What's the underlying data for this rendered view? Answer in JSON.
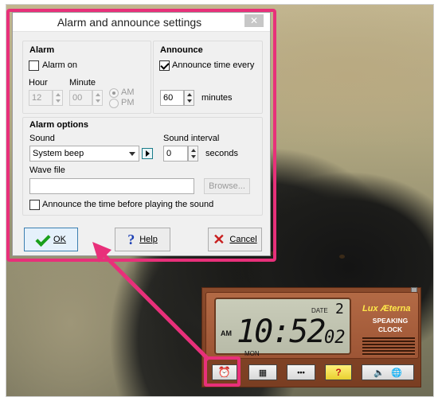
{
  "dialog": {
    "title": "Alarm and announce settings",
    "close": "✕",
    "alarm_group": {
      "title": "Alarm",
      "alarm_on_label": "Alarm on",
      "alarm_on_checked": false,
      "hour_label": "Hour",
      "minute_label": "Minute",
      "hour_value": "12",
      "minute_value": "00",
      "am_label": "AM",
      "pm_label": "PM",
      "selected_period": "AM"
    },
    "announce_group": {
      "title": "Announce",
      "announce_label": "Announce time every",
      "announce_checked": true,
      "interval_value": "60",
      "interval_unit": "minutes"
    },
    "alarm_options": {
      "title": "Alarm options",
      "sound_label": "Sound",
      "sound_value": "System beep",
      "sound_interval_label": "Sound interval",
      "sound_interval_value": "0",
      "sound_interval_unit": "seconds",
      "wave_file_label": "Wave file",
      "wave_file_value": "",
      "browse_label": "Browse...",
      "announce_before_label": "Announce the time before playing the sound",
      "announce_before_checked": false
    },
    "buttons": {
      "ok": "OK",
      "help": "Help",
      "cancel": "Cancel"
    }
  },
  "clock": {
    "date_label": "DATE",
    "day": "2",
    "ampm": "AM",
    "time": "10:52",
    "seconds": "02",
    "weekday": "MON",
    "brand": "Lux Æterna",
    "brand_sub": "SPEAKING CLOCK",
    "toolbar": [
      "alarm-clock",
      "keypad",
      "more",
      "help",
      "speaker-globe"
    ],
    "more_label": "•••",
    "help_label": "?"
  },
  "colors": {
    "highlight": "#e8307a",
    "lcd": "#c2c5b2",
    "clock_body": "#8a4b2c",
    "brand_yellow": "#ffe84a"
  }
}
